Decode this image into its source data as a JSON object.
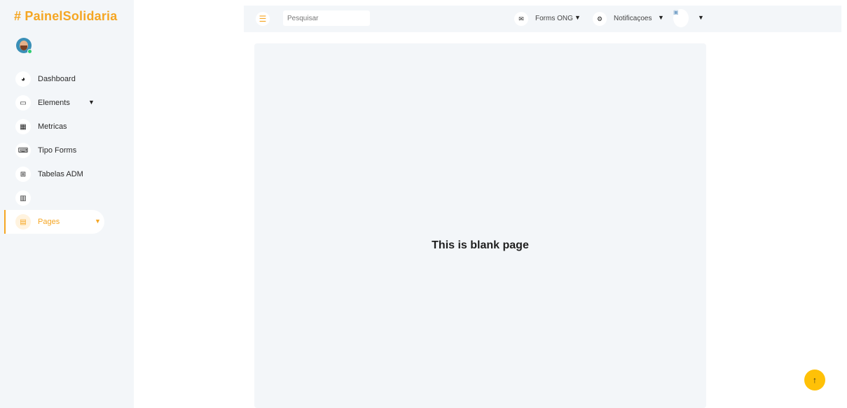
{
  "brand": "# PainelSolidaria",
  "sidebar": {
    "items": [
      {
        "label": "Dashboard",
        "icon": "tachometer-icon"
      },
      {
        "label": "Elements",
        "icon": "laptop-icon",
        "has_chevron": true
      },
      {
        "label": "Metricas",
        "icon": "grid-icon"
      },
      {
        "label": "Tipo Forms",
        "icon": "keyboard-icon"
      },
      {
        "label": "Tabelas ADM",
        "icon": "table-icon"
      },
      {
        "label": "",
        "icon": "chart-icon"
      },
      {
        "label": "Pages",
        "icon": "file-icon",
        "has_chevron": true,
        "active": true
      }
    ]
  },
  "topbar": {
    "search_placeholder": "Pesquisar",
    "forms_label": "Forms ONG",
    "notifications_label": "Notificaçoes"
  },
  "main": {
    "title": "This is blank page"
  },
  "colors": {
    "accent": "#f5a623",
    "panel_bg": "#f3f6f9",
    "scroll_button": "#ffc107"
  }
}
